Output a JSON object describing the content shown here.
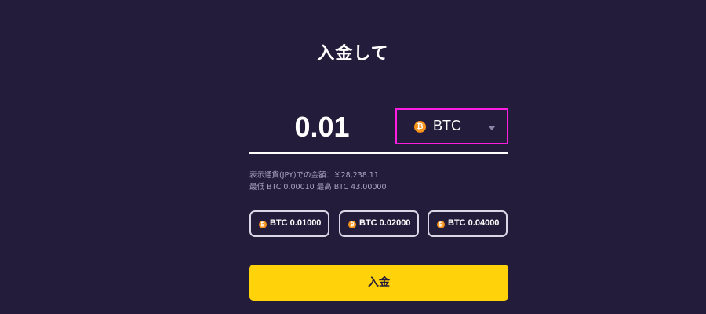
{
  "title": "入金して",
  "amount": {
    "value": "0.01"
  },
  "currency": {
    "selected": "BTC",
    "coin_symbol": "₿",
    "icon": "bitcoin-icon",
    "dropdown_icon": "caret-down-icon"
  },
  "info": {
    "fiat_line": "表示通貨(JPY)での金額：￥28,238.11",
    "limits_line": "最低 BTC 0.00010 最高 BTC 43.00000"
  },
  "presets": [
    {
      "label": "BTC 0.01000"
    },
    {
      "label": "BTC 0.02000"
    },
    {
      "label": "BTC 0.04000"
    }
  ],
  "deposit_button": {
    "label": "入金"
  },
  "colors": {
    "background": "#231c3a",
    "accent_yellow": "#ffd20a",
    "highlight_magenta": "#ff1fe0",
    "bitcoin_orange": "#f7931a"
  }
}
